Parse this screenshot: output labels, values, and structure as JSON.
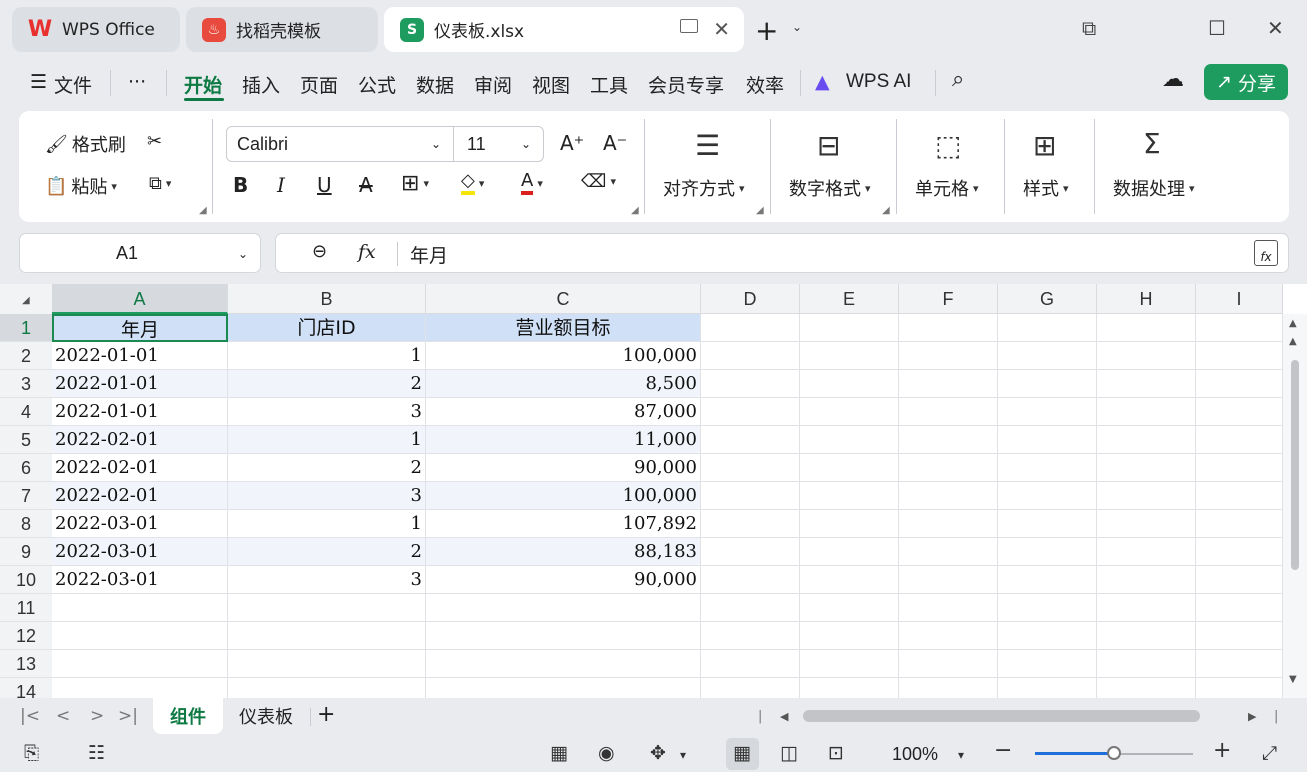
{
  "tabs": [
    {
      "label": "WPS Office",
      "icon": "wps-logo-icon",
      "color": "#e8312f"
    },
    {
      "label": "找稻壳模板",
      "icon": "daoke-logo-icon",
      "color": "#e84a3d"
    },
    {
      "label": "仪表板.xlsx",
      "icon": "spreadsheet-s-icon",
      "color": "#1e9b5e",
      "icon_text": "S"
    }
  ],
  "menu": {
    "file_label": "文件",
    "more_label": "···",
    "items": [
      "开始",
      "插入",
      "页面",
      "公式",
      "数据",
      "审阅",
      "视图",
      "工具",
      "会员专享",
      "效率"
    ],
    "active": "开始",
    "ai_label": "WPS AI",
    "share_label": "分享"
  },
  "ribbon": {
    "format_painter": "格式刷",
    "paste": "粘贴",
    "font_name": "Calibri",
    "font_size": "11",
    "align": "对齐方式",
    "number_format": "数字格式",
    "cells": "单元格",
    "styles": "样式",
    "data_processing": "数据处理"
  },
  "formula_bar": {
    "name_box": "A1",
    "fx": "fx",
    "content": "年月"
  },
  "columns": [
    "A",
    "B",
    "C",
    "D",
    "E",
    "F",
    "G",
    "H",
    "I"
  ],
  "rows": [
    "1",
    "2",
    "3",
    "4",
    "5",
    "6",
    "7",
    "8",
    "9",
    "10",
    "11",
    "12",
    "13",
    "14"
  ],
  "table": {
    "headers": [
      "年月",
      "门店ID",
      "营业额目标"
    ],
    "rows": [
      [
        "2022-01-01",
        "1",
        "100,000"
      ],
      [
        "2022-01-01",
        "2",
        "8,500"
      ],
      [
        "2022-01-01",
        "3",
        "87,000"
      ],
      [
        "2022-02-01",
        "1",
        "11,000"
      ],
      [
        "2022-02-01",
        "2",
        "90,000"
      ],
      [
        "2022-02-01",
        "3",
        "100,000"
      ],
      [
        "2022-03-01",
        "1",
        "107,892"
      ],
      [
        "2022-03-01",
        "2",
        "88,183"
      ],
      [
        "2022-03-01",
        "3",
        "90,000"
      ]
    ]
  },
  "sheets": [
    "组件",
    "仪表板"
  ],
  "active_sheet": "组件",
  "status": {
    "zoom": "100%",
    "zoom_level": 0.5
  },
  "colors": {
    "accent": "#0d7a43",
    "header_fill": "#cfe0f7",
    "band_fill": "#f1f5fb"
  }
}
